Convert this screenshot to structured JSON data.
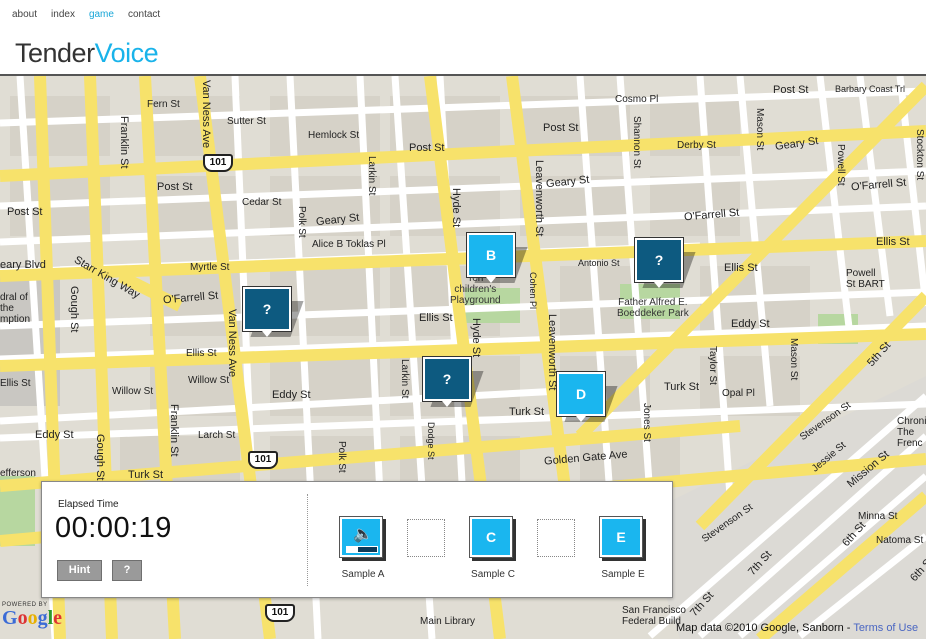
{
  "nav": {
    "about": "about",
    "index": "index",
    "game": "game",
    "contact": "contact"
  },
  "logo": {
    "part1": "Tender",
    "part2": "Voice"
  },
  "map": {
    "streets": {
      "fern": "Fern St",
      "sutter1": "Sutter St",
      "post1": "Post St",
      "post2": "Post St",
      "post3": "Post St",
      "post4": "Post St",
      "post5": "Post St",
      "hemlock": "Hemlock St",
      "cedar": "Cedar St",
      "geary1": "Geary St",
      "geary2": "Geary St",
      "geary3": "Geary St",
      "alice": "Alice B Toklas Pl",
      "myrtle": "Myrtle St",
      "ofarrell1": "O'Farrell St",
      "ofarrell2": "O'Farrell St",
      "ofarrell3": "O'Farrell St",
      "ellis1": "Ellis St",
      "ellis2": "Ellis St",
      "ellis3": "Ellis St",
      "ellis4": "Ellis St",
      "ellis5": "Ellis St",
      "willow1": "Willow St",
      "willow2": "Willow St",
      "eddy1": "Eddy St",
      "eddy2": "Eddy St",
      "eddy3": "Eddy St",
      "larch": "Larch St",
      "turk1": "Turk St",
      "turk2": "Turk St",
      "turk3": "Turk St",
      "golden": "Golden Gate Ave",
      "franklin1": "Franklin St",
      "franklin2": "Franklin St",
      "gough1": "Gough St",
      "gough2": "Gough St",
      "vanness1": "Van Ness Ave",
      "vanness2": "Van Ness Ave",
      "polk1": "Polk St",
      "polk2": "Polk St",
      "larkin1": "Larkin St",
      "larkin2": "Larkin St",
      "hyde1": "Hyde St",
      "hyde2": "Hyde St",
      "leavenworth1": "Leavenworth St",
      "leavenworth2": "Leavenworth St",
      "jones": "Jones St",
      "taylor": "Taylor St",
      "mason1": "Mason St",
      "mason2": "Mason St",
      "powell": "Powell St",
      "stockton": "Stockton St",
      "shannon": "Shannon St",
      "antonio": "Antonio St",
      "derby": "Derby St",
      "cosmo": "Cosmo Pl",
      "opal": "Opal Pl",
      "cohen": "Cohen Pl",
      "dodge": "Dodge St",
      "starr": "Starr King Way",
      "gearyblvd": "eary Blvd",
      "barbary": "Barbary Coast Trl",
      "stevenson1": "Stevenson St",
      "stevenson2": "Stevenson St",
      "jessie": "Jessie St",
      "mission": "Mission St",
      "minna": "Minna St",
      "natoma": "Natoma St",
      "fifth": "5th St",
      "sixth1": "6th St",
      "sixth2": "6th St",
      "seventh1": "7th St",
      "seventh2": "7th St",
      "powellbart": "Powell\nSt BART",
      "mainlib": "Main Library",
      "sflib": "San Francisco\nFederal Build",
      "tenderlabel": "Ten\nchildren's\nPlayground",
      "boeddeker": "Father Alfred E.\nBoeddeker Park",
      "cathedral": "dral of\nthe\nmption",
      "jefferson": "efferson",
      "chron": "Chroni\nThe\nFrenc"
    },
    "shields": {
      "s1": "101",
      "s2": "101",
      "s3": "101"
    }
  },
  "markers": {
    "m1": "?",
    "m2": "B",
    "m3": "?",
    "m4": "?",
    "m5": "D"
  },
  "panel": {
    "elapsed_label": "Elapsed Time",
    "timer": "00:00:19",
    "hint_label": "Hint",
    "help_label": "?",
    "samples": [
      {
        "label": "Sample A",
        "type": "audio",
        "progress": 0.35
      },
      {
        "label": "",
        "type": "empty"
      },
      {
        "label": "Sample C",
        "type": "letter",
        "letter": "C"
      },
      {
        "label": "",
        "type": "empty"
      },
      {
        "label": "Sample E",
        "type": "letter",
        "letter": "E"
      }
    ]
  },
  "google": {
    "powered": "POWERED BY",
    "g": "G",
    "o1": "o",
    "o2": "o",
    "g2": "g",
    "l": "l",
    "e": "e"
  },
  "mapdata": {
    "text": "Map data ©2010 Google, Sanborn - ",
    "terms": "Terms of Use"
  },
  "colors": {
    "accent": "#19b3ea",
    "marker_dark": "#0d5a80",
    "marker_light": "#1ab6ef",
    "road_major": "#f7e26b",
    "road_minor": "#ffffff",
    "block": "#e0ddd4"
  }
}
